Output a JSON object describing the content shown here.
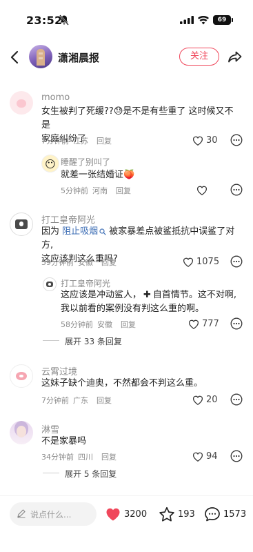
{
  "status_bar": {
    "time": "23:52",
    "battery": "69"
  },
  "header": {
    "channel_name": "潇湘晨报",
    "follow_label": "关注"
  },
  "comments": [
    {
      "username": "momo",
      "text_line1": "女生被判了死缓??",
      "text_line1_tail": "是不是有些重了 这时候又不是",
      "text_line2": "家庭纠纷了",
      "time": "7分钟前",
      "location": "江苏",
      "reply_label": "回复",
      "likes": "30",
      "replies": [
        {
          "username": "睡醒了别叫了",
          "text": "就差一张结婚证",
          "time": "5分钟前",
          "location": "河南",
          "reply_label": "回复",
          "likes": ""
        }
      ]
    },
    {
      "username": "打工皇帝阿光",
      "text_prefix": "因为 ",
      "text_highlight": "阻止吸烟",
      "text_line1_tail": " 被家暴差点被鲨抵抗中误鲨了对方,",
      "text_line2": "这应该判这么重吗?",
      "time": "59分钟前",
      "location": "安徽",
      "reply_label": "回复",
      "likes": "1075",
      "replies": [
        {
          "username": "打工皇帝阿光",
          "text_line1": "这应该是冲动鲨人，",
          "text_line1_tail": "自首情节。这不对啊,",
          "text_line2": "我以前看的案例没有判这么重的啊。",
          "time": "58分钟前",
          "location": "安徽",
          "reply_label": "回复",
          "likes": "777"
        }
      ],
      "expand_label": "展开 33 条回复"
    },
    {
      "username": "云霄过境",
      "text": "这妹子缺个迪奥，不然都会不判这么重。",
      "time": "7分钟前",
      "location": "广东",
      "reply_label": "回复",
      "likes": "20"
    },
    {
      "username": "淋雪",
      "text": "不是家暴吗",
      "time": "34分钟前",
      "location": "四川",
      "reply_label": "回复",
      "likes": "94",
      "expand_label": "展开 5 条回复"
    }
  ],
  "bottom_bar": {
    "input_placeholder": "说点什么...",
    "likes": "3200",
    "favorites": "193",
    "comments": "1573"
  },
  "colors": {
    "accent": "#f0475b",
    "link": "#3d6eb5",
    "muted": "#8a8a8a"
  },
  "icons": [
    "bell-off-icon",
    "signal-icon",
    "wifi-icon",
    "battery-icon",
    "back-arrow-icon",
    "share-icon",
    "heart-outline-icon",
    "more-options-icon",
    "heart-filled-icon",
    "star-icon",
    "comment-bubble-icon",
    "pencil-icon"
  ]
}
